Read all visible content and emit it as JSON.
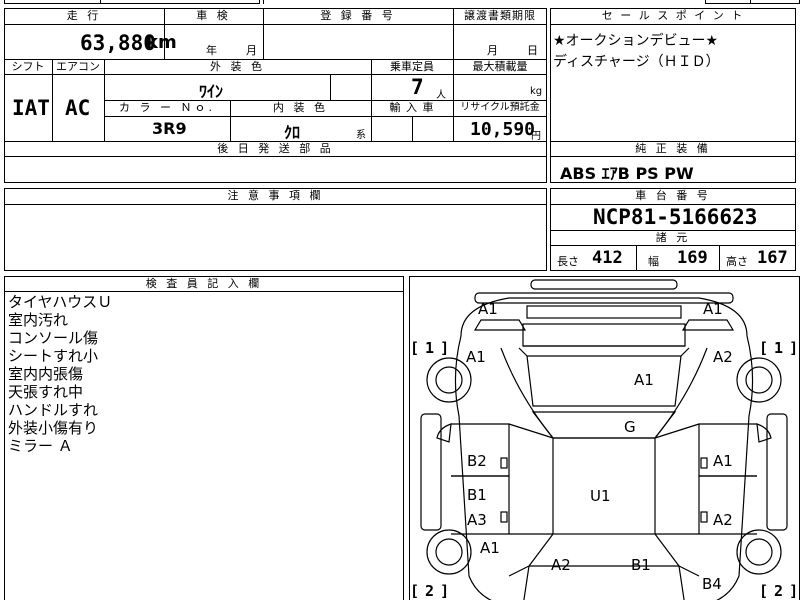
{
  "top_partial": {
    "left": "",
    "mid": "",
    "right": ""
  },
  "header_row": {
    "mileage_label": "走 行",
    "inspection_label": "車 検",
    "registration_label": "登 録 番 号",
    "transfer_label": "譲渡書類期限",
    "selling_points_label": "セ ー ル ス ポ イ ン ト"
  },
  "mileage": {
    "value": "63,880",
    "unit": "km"
  },
  "inspection": {
    "year": "年",
    "month": "月"
  },
  "transfer": {
    "month": "月",
    "day": "日"
  },
  "selling_points": [
    "★オークションデビュー★",
    "ディスチャージ（ＨＩＤ）"
  ],
  "row2_labels": {
    "shift": "シフト",
    "aircon": "エアコン",
    "exterior_color": "外 装 色",
    "capacity": "乗車定員",
    "max_load": "最大積載量"
  },
  "shift": "IAT",
  "aircon": "AC",
  "exterior_color": "ﾜｲﾝ",
  "capacity": {
    "value": "7",
    "unit": "人"
  },
  "max_load": {
    "unit": "kg"
  },
  "row3_labels": {
    "color_no": "カ ラ ー Ｎｏ.",
    "interior_color": "内 装 色",
    "import": "輸 入 車",
    "recycle": "リサイクル預託金"
  },
  "color_no": "3R9",
  "interior_color": {
    "value": "ｸﾛ",
    "suffix": "系"
  },
  "recycle": {
    "value": "10,590",
    "unit": "円"
  },
  "delivery_parts_label": "後 日 発 送 部 品",
  "equipment_label": "純 正 装 備",
  "equipment": "ABS ｴｱB PS PW",
  "notes_label": "注 意 事 項 欄",
  "chassis_label": "車 台 番 号",
  "chassis_number": "NCP81-5166623",
  "specs_label": "諸 元",
  "dimensions": {
    "length_label": "長さ",
    "length": "412",
    "width_label": "幅",
    "width": "169",
    "height_label": "高さ",
    "height": "167"
  },
  "inspector_label": "検 査 員 記 入 欄",
  "inspector_notes": [
    "タイヤハウスＵ",
    "室内汚れ",
    "コンソール傷",
    "シートすれ小",
    "室内内張傷",
    "天張すれ中",
    "ハンドルすれ",
    "外装小傷有り",
    "ミラー Ａ"
  ],
  "damage_marks": {
    "front_left_top": "A1",
    "front_right_top": "A1",
    "fender_left": "A1",
    "fender_right": "A2",
    "hood": "A1",
    "windshield": "G",
    "front_door_left": "B2",
    "front_door_right": "A1",
    "rear_door_left_b": "B1",
    "rear_door_left_a": "A3",
    "roof": "U1",
    "rear_door_right": "A2",
    "rear_fender_left": "A1",
    "rear_left": "A2",
    "rear_right": "B1",
    "rear_bumper_right": "B4"
  },
  "tire_markers": {
    "front_left": "1",
    "front_right": "1",
    "rear_left": "2",
    "rear_right": "2"
  }
}
